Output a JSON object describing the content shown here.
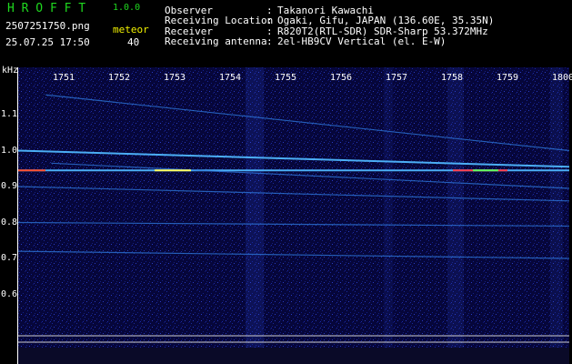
{
  "header": {
    "app_title": "H R O F F T",
    "version": "1.0.0",
    "filename": "2507251750.png",
    "meteor_label": "meteor",
    "datetime": "25.07.25 17:50",
    "meteor_count": "40"
  },
  "info": [
    {
      "key": "Observer",
      "value": "Takanori Kawachi"
    },
    {
      "key": "Receiving Location",
      "value": "Ogaki, Gifu, JAPAN (136.60E, 35.35N)"
    },
    {
      "key": "Receiver",
      "value": "R820T2(RTL-SDR) SDR-Sharp 53.372MHz"
    },
    {
      "key": "Receiving antenna",
      "value": "2el-HB9CV Vertical (el. E-W)"
    }
  ],
  "colors": {
    "background": "#000000",
    "spectrogram_bg": "#06063a",
    "title_green": "#1fd81f",
    "text_white": "#ffffff",
    "signal_cyan": "#3fa6ff",
    "meteor_yellow": "#f2f200"
  },
  "chart_data": {
    "type": "heatmap",
    "ylabel": "kHz",
    "y_ticks": [
      "1.1",
      "1.0",
      "0.9",
      "0.8",
      "0.7",
      "0.6"
    ],
    "x_ticks": [
      "1751",
      "1752",
      "1753",
      "1754",
      "1755",
      "1756",
      "1757",
      "1758",
      "1759",
      "1800"
    ],
    "ylim": [
      0.6,
      1.16
    ],
    "xlim": [
      1750,
      1800
    ],
    "traces": [
      {
        "from": [
          1750,
          1.0
        ],
        "to": [
          1800,
          0.955
        ]
      },
      {
        "from": [
          1750,
          0.945
        ],
        "to": [
          1800,
          0.945
        ]
      },
      {
        "from": [
          1752.5,
          1.155
        ],
        "to": [
          1800,
          1.0
        ]
      },
      {
        "from": [
          1753,
          0.965
        ],
        "to": [
          1800,
          0.895
        ]
      },
      {
        "from": [
          1750,
          0.9
        ],
        "to": [
          1800,
          0.86
        ]
      },
      {
        "from": [
          1750,
          0.8
        ],
        "to": [
          1800,
          0.79
        ]
      },
      {
        "from": [
          1750,
          0.72
        ],
        "to": [
          1800,
          0.7
        ]
      }
    ]
  }
}
